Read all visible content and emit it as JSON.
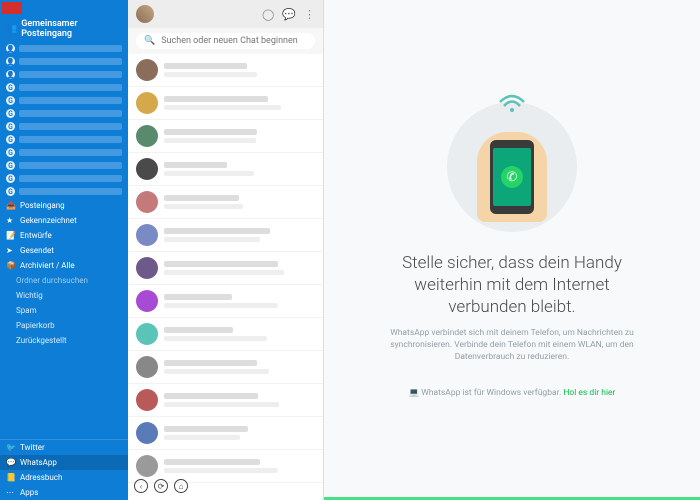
{
  "window": {
    "help": "?",
    "min": "_",
    "max": "□",
    "close": "✕"
  },
  "sidebar": {
    "header": "Gemeinsamer Posteingang",
    "accounts": [
      {
        "initial": "👤"
      },
      {
        "initial": "👤"
      },
      {
        "initial": "👤"
      },
      {
        "initial": "G"
      },
      {
        "initial": "G"
      },
      {
        "initial": "G"
      },
      {
        "initial": "G"
      },
      {
        "initial": "G"
      },
      {
        "initial": "G"
      },
      {
        "initial": "G"
      },
      {
        "initial": "G"
      },
      {
        "initial": "G"
      }
    ],
    "folders": [
      {
        "icon": "📥",
        "label": "Posteingang"
      },
      {
        "icon": "★",
        "label": "Gekennzeichnet"
      },
      {
        "icon": "📝",
        "label": "Entwürfe"
      },
      {
        "icon": "➤",
        "label": "Gesendet"
      },
      {
        "icon": "📦",
        "label": "Archiviert / Alle"
      }
    ],
    "search_placeholder": "Ordner durchsuchen",
    "subfolders": [
      "Wichtig",
      "Spam",
      "Papierkorb",
      "Zurückgestellt"
    ],
    "bottom": [
      {
        "icon": "🐦",
        "label": "Twitter"
      },
      {
        "icon": "💬",
        "label": "WhatsApp",
        "selected": true
      },
      {
        "icon": "📒",
        "label": "Adressbuch"
      },
      {
        "icon": "⋯",
        "label": "Apps"
      }
    ]
  },
  "chat": {
    "search_placeholder": "Suchen oder neuen Chat beginnen",
    "count": 13
  },
  "main": {
    "title": "Stelle sicher, dass dein Handy weiterhin mit dem Internet verbunden bleibt.",
    "subtitle": "WhatsApp verbindet sich mit deinem Telefon, um Nachrichten zu synchronisieren. Verbinde dein Telefon mit einem WLAN, um den Datenverbrauch zu reduzieren.",
    "download_prefix": "💻 WhatsApp ist für Windows verfügbar. ",
    "download_link": "Hol es dir hier"
  }
}
